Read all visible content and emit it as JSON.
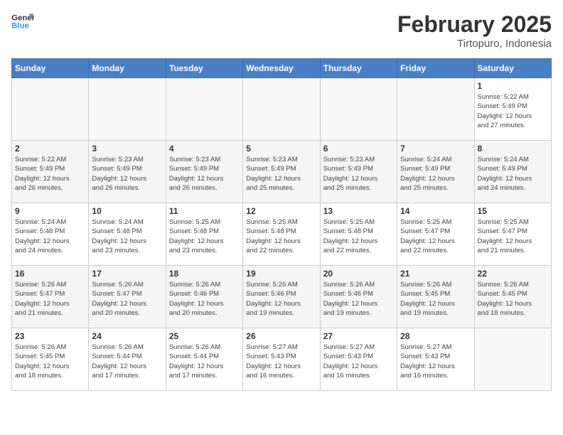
{
  "logo": {
    "line1": "General",
    "line2": "Blue"
  },
  "title": "February 2025",
  "location": "Tirtopuro, Indonesia",
  "weekdays": [
    "Sunday",
    "Monday",
    "Tuesday",
    "Wednesday",
    "Thursday",
    "Friday",
    "Saturday"
  ],
  "weeks": [
    [
      {
        "day": "",
        "info": ""
      },
      {
        "day": "",
        "info": ""
      },
      {
        "day": "",
        "info": ""
      },
      {
        "day": "",
        "info": ""
      },
      {
        "day": "",
        "info": ""
      },
      {
        "day": "",
        "info": ""
      },
      {
        "day": "1",
        "info": "Sunrise: 5:22 AM\nSunset: 5:49 PM\nDaylight: 12 hours\nand 27 minutes."
      }
    ],
    [
      {
        "day": "2",
        "info": "Sunrise: 5:22 AM\nSunset: 5:49 PM\nDaylight: 12 hours\nand 26 minutes."
      },
      {
        "day": "3",
        "info": "Sunrise: 5:23 AM\nSunset: 5:49 PM\nDaylight: 12 hours\nand 26 minutes."
      },
      {
        "day": "4",
        "info": "Sunrise: 5:23 AM\nSunset: 5:49 PM\nDaylight: 12 hours\nand 26 minutes."
      },
      {
        "day": "5",
        "info": "Sunrise: 5:23 AM\nSunset: 5:49 PM\nDaylight: 12 hours\nand 25 minutes."
      },
      {
        "day": "6",
        "info": "Sunrise: 5:23 AM\nSunset: 5:49 PM\nDaylight: 12 hours\nand 25 minutes."
      },
      {
        "day": "7",
        "info": "Sunrise: 5:24 AM\nSunset: 5:49 PM\nDaylight: 12 hours\nand 25 minutes."
      },
      {
        "day": "8",
        "info": "Sunrise: 5:24 AM\nSunset: 5:49 PM\nDaylight: 12 hours\nand 24 minutes."
      }
    ],
    [
      {
        "day": "9",
        "info": "Sunrise: 5:24 AM\nSunset: 5:48 PM\nDaylight: 12 hours\nand 24 minutes."
      },
      {
        "day": "10",
        "info": "Sunrise: 5:24 AM\nSunset: 5:48 PM\nDaylight: 12 hours\nand 23 minutes."
      },
      {
        "day": "11",
        "info": "Sunrise: 5:25 AM\nSunset: 5:48 PM\nDaylight: 12 hours\nand 23 minutes."
      },
      {
        "day": "12",
        "info": "Sunrise: 5:25 AM\nSunset: 5:48 PM\nDaylight: 12 hours\nand 22 minutes."
      },
      {
        "day": "13",
        "info": "Sunrise: 5:25 AM\nSunset: 5:48 PM\nDaylight: 12 hours\nand 22 minutes."
      },
      {
        "day": "14",
        "info": "Sunrise: 5:25 AM\nSunset: 5:47 PM\nDaylight: 12 hours\nand 22 minutes."
      },
      {
        "day": "15",
        "info": "Sunrise: 5:25 AM\nSunset: 5:47 PM\nDaylight: 12 hours\nand 21 minutes."
      }
    ],
    [
      {
        "day": "16",
        "info": "Sunrise: 5:26 AM\nSunset: 5:47 PM\nDaylight: 12 hours\nand 21 minutes."
      },
      {
        "day": "17",
        "info": "Sunrise: 5:26 AM\nSunset: 5:47 PM\nDaylight: 12 hours\nand 20 minutes."
      },
      {
        "day": "18",
        "info": "Sunrise: 5:26 AM\nSunset: 5:46 PM\nDaylight: 12 hours\nand 20 minutes."
      },
      {
        "day": "19",
        "info": "Sunrise: 5:26 AM\nSunset: 5:46 PM\nDaylight: 12 hours\nand 19 minutes."
      },
      {
        "day": "20",
        "info": "Sunrise: 5:26 AM\nSunset: 5:46 PM\nDaylight: 12 hours\nand 19 minutes."
      },
      {
        "day": "21",
        "info": "Sunrise: 5:26 AM\nSunset: 5:45 PM\nDaylight: 12 hours\nand 19 minutes."
      },
      {
        "day": "22",
        "info": "Sunrise: 5:26 AM\nSunset: 5:45 PM\nDaylight: 12 hours\nand 18 minutes."
      }
    ],
    [
      {
        "day": "23",
        "info": "Sunrise: 5:26 AM\nSunset: 5:45 PM\nDaylight: 12 hours\nand 18 minutes."
      },
      {
        "day": "24",
        "info": "Sunrise: 5:26 AM\nSunset: 5:44 PM\nDaylight: 12 hours\nand 17 minutes."
      },
      {
        "day": "25",
        "info": "Sunrise: 5:26 AM\nSunset: 5:44 PM\nDaylight: 12 hours\nand 17 minutes."
      },
      {
        "day": "26",
        "info": "Sunrise: 5:27 AM\nSunset: 5:43 PM\nDaylight: 12 hours\nand 16 minutes."
      },
      {
        "day": "27",
        "info": "Sunrise: 5:27 AM\nSunset: 5:43 PM\nDaylight: 12 hours\nand 16 minutes."
      },
      {
        "day": "28",
        "info": "Sunrise: 5:27 AM\nSunset: 5:43 PM\nDaylight: 12 hours\nand 16 minutes."
      },
      {
        "day": "",
        "info": ""
      }
    ]
  ]
}
